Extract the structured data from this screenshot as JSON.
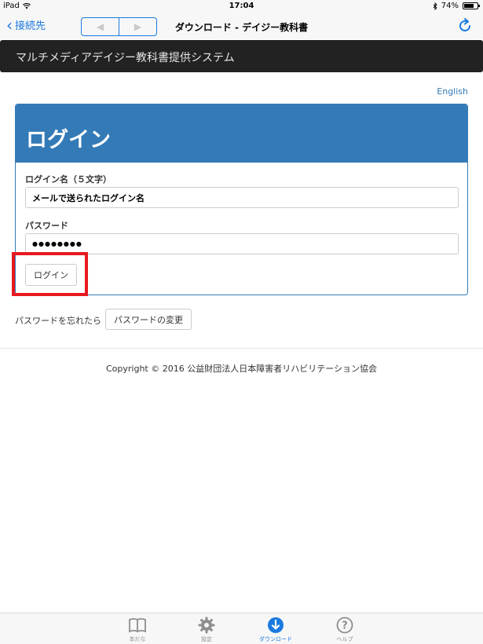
{
  "status_bar": {
    "device": "iPad",
    "time": "17:04",
    "battery": "74%",
    "battery_level": 0.74
  },
  "nav_bar": {
    "back_label": "接続先",
    "title": "ダウンロード - デイジー教科書",
    "prev_icon": "◀",
    "next_icon": "▶"
  },
  "site": {
    "header_title": "マルチメディアデイジー教科書提供システム",
    "english_link": "English"
  },
  "login": {
    "heading": "ログイン",
    "username_label": "ログイン名（５文字）",
    "username_value": "メールで送られたログイン名",
    "password_label": "パスワード",
    "password_value": "●●●●●●●●",
    "login_button": "ログイン"
  },
  "forgot": {
    "text": "パスワードを忘れたら",
    "change_button": "パスワードの変更"
  },
  "footer": {
    "copyright": "Copyright © 2016 公益財団法人日本障害者リハビリテーション協会"
  },
  "tab_bar": {
    "tabs": [
      {
        "label": "本だな",
        "icon": "book-icon"
      },
      {
        "label": "設定",
        "icon": "gear-icon"
      },
      {
        "label": "ダウンロード",
        "icon": "download-icon",
        "active": true
      },
      {
        "label": "ヘルプ",
        "icon": "help-icon"
      }
    ]
  },
  "colors": {
    "accent": "#1a7ae0",
    "panel": "#337ab7",
    "header": "#222222",
    "highlight": "#e8191f"
  }
}
